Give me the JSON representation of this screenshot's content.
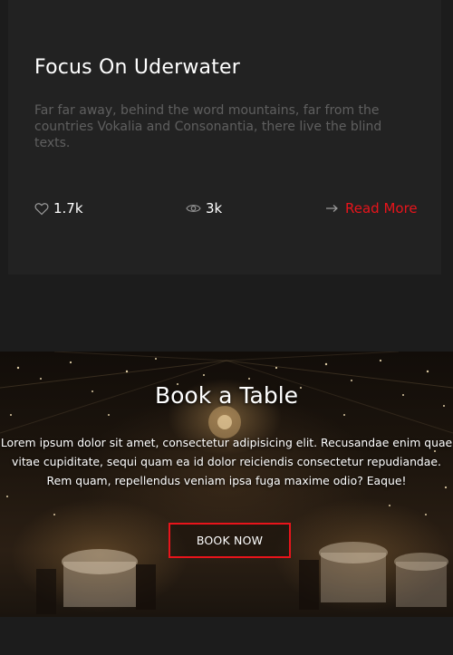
{
  "card": {
    "title": "Focus On Uderwater",
    "excerpt": "Far far away, behind the word mountains, far from the countries Vokalia and Consonantia, there live the blind texts.",
    "likes": "1.7k",
    "views": "3k",
    "read_more": "Read More",
    "icons": {
      "likes": "heart-icon",
      "views": "eye-icon",
      "read_more": "arrow-right-icon"
    }
  },
  "banner": {
    "title": "Book a Table",
    "text": "Lorem ipsum dolor sit amet, consectetur adipisicing elit. Recusandae enim quae vitae cupiditate, sequi quam ea id dolor reiciendis consectetur repudiandae. Rem quam, repellendus veniam ipsa fuga maxime odio? Eaque!",
    "button": "BOOK NOW"
  },
  "colors": {
    "page_background": "#1c1c1c",
    "card_background": "#222222",
    "accent": "#e8141b",
    "excerpt_text": "#5f5f5f"
  }
}
